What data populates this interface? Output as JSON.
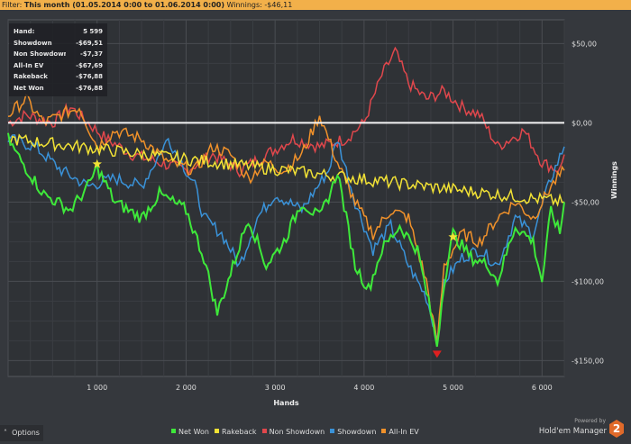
{
  "filter": {
    "label": "Filter:",
    "value": "This month (01.05.2014 0:00 to 01.06.2014 0:00)",
    "winnings_label": "Winnings:",
    "winnings_value": "-$46,11"
  },
  "tooltip": {
    "rows": [
      {
        "k": "Hand:",
        "v": "5 599"
      },
      {
        "k": "Showdown",
        "v": "-$69,51"
      },
      {
        "k": "Non Showdown",
        "v": "-$7,37"
      },
      {
        "k": "All-In EV",
        "v": "-$67,69"
      },
      {
        "k": "Rakeback",
        "v": "-$76,88"
      },
      {
        "k": "Net Won",
        "v": "-$76,88"
      }
    ]
  },
  "options_label": "Options",
  "powered_by": "Powered by",
  "brand": "Hold'em Manager",
  "brand_logo": "2",
  "chart_data": {
    "type": "line",
    "xlabel": "Hands",
    "ylabel": "Winnings",
    "xlim": [
      0,
      6250
    ],
    "ylim": [
      -160,
      65
    ],
    "xticks": [
      {
        "v": 1000,
        "label": "1 000"
      },
      {
        "v": 2000,
        "label": "2 000"
      },
      {
        "v": 3000,
        "label": "3 000"
      },
      {
        "v": 4000,
        "label": "4 000"
      },
      {
        "v": 5000,
        "label": "5 000"
      },
      {
        "v": 6000,
        "label": "6 000"
      }
    ],
    "yticks": [
      {
        "v": 50,
        "label": "$50,00"
      },
      {
        "v": 0,
        "label": "$0,00"
      },
      {
        "v": -50,
        "label": "-$50,00"
      },
      {
        "v": -100,
        "label": "-$100,00"
      },
      {
        "v": -150,
        "label": "-$150,00"
      }
    ],
    "series": [
      {
        "name": "Non Showdown",
        "color": "#e0474c",
        "x": [
          0,
          200,
          500,
          700,
          900,
          1100,
          1400,
          1700,
          2000,
          2300,
          2600,
          2900,
          3200,
          3500,
          3800,
          4000,
          4200,
          4350,
          4500,
          4700,
          4900,
          5100,
          5300,
          5500,
          5800,
          6000,
          6200,
          6250
        ],
        "y": [
          0,
          5,
          0,
          10,
          0,
          -10,
          -20,
          -25,
          -30,
          -20,
          -30,
          -20,
          -10,
          -15,
          -10,
          0,
          30,
          45,
          25,
          15,
          20,
          10,
          5,
          -15,
          -5,
          -25,
          -30,
          -20
        ]
      },
      {
        "name": "Showdown",
        "color": "#3a92d8",
        "x": [
          0,
          300,
          600,
          900,
          1200,
          1500,
          1800,
          2100,
          2200,
          2400,
          2600,
          2800,
          3000,
          3300,
          3600,
          3700,
          3900,
          4100,
          4300,
          4500,
          4700,
          4820,
          4900,
          5100,
          5300,
          5500,
          5700,
          5900,
          6100,
          6250
        ],
        "y": [
          -10,
          -15,
          -30,
          -40,
          -35,
          -40,
          -10,
          -40,
          -60,
          -70,
          -90,
          -60,
          -45,
          -55,
          -30,
          -10,
          -50,
          -80,
          -65,
          -90,
          -110,
          -135,
          -100,
          -85,
          -80,
          -90,
          -60,
          -70,
          -35,
          -15
        ]
      },
      {
        "name": "All-In EV",
        "color": "#f0912a",
        "x": [
          0,
          200,
          400,
          600,
          800,
          1000,
          1200,
          1500,
          1800,
          2100,
          2300,
          2500,
          2700,
          2900,
          3100,
          3300,
          3500,
          3700,
          3900,
          4100,
          4300,
          4500,
          4700,
          4820,
          4900,
          5100,
          5300,
          5500,
          5700,
          5900,
          6100,
          6250
        ],
        "y": [
          5,
          15,
          0,
          5,
          10,
          -15,
          -5,
          -10,
          -25,
          -30,
          -15,
          -20,
          -35,
          -25,
          -30,
          -20,
          5,
          -25,
          -50,
          -70,
          -55,
          -60,
          -100,
          -140,
          -90,
          -70,
          -75,
          -60,
          -50,
          -60,
          -40,
          -30
        ]
      },
      {
        "name": "Rakeback",
        "color": "#f2e235",
        "x": [
          0,
          6250
        ],
        "y": [
          -10,
          -50
        ]
      },
      {
        "name": "Net Won",
        "color": "#3ee83a",
        "x": [
          0,
          100,
          400,
          700,
          900,
          1000,
          1200,
          1500,
          1700,
          2000,
          2200,
          2350,
          2500,
          2700,
          2900,
          3100,
          3300,
          3500,
          3650,
          3700,
          3800,
          3900,
          4050,
          4200,
          4400,
          4600,
          4750,
          4820,
          4900,
          5000,
          5200,
          5400,
          5500,
          5700,
          5900,
          6000,
          6100,
          6200,
          6250
        ],
        "y": [
          -10,
          -20,
          -45,
          -55,
          -40,
          -28,
          -50,
          -60,
          -45,
          -55,
          -85,
          -120,
          -95,
          -60,
          -90,
          -75,
          -50,
          -60,
          -40,
          -30,
          -60,
          -90,
          -105,
          -80,
          -65,
          -80,
          -120,
          -140,
          -100,
          -70,
          -85,
          -90,
          -100,
          -65,
          -75,
          -100,
          -55,
          -70,
          -50
        ]
      }
    ],
    "markers": [
      {
        "type": "star",
        "color": "#f2e235",
        "x": 1000,
        "y": -26
      },
      {
        "type": "star",
        "color": "#f2e235",
        "x": 5000,
        "y": -72
      },
      {
        "type": "triangle-down",
        "color": "#e02020",
        "x": 4820,
        "y": -146
      }
    ],
    "legend": [
      {
        "name": "Net Won",
        "color": "#3ee83a"
      },
      {
        "name": "Rakeback",
        "color": "#f2e235"
      },
      {
        "name": "Non Showdown",
        "color": "#e0474c"
      },
      {
        "name": "Showdown",
        "color": "#3a92d8"
      },
      {
        "name": "All-In EV",
        "color": "#f0912a"
      }
    ],
    "legend_position": "bottom"
  }
}
